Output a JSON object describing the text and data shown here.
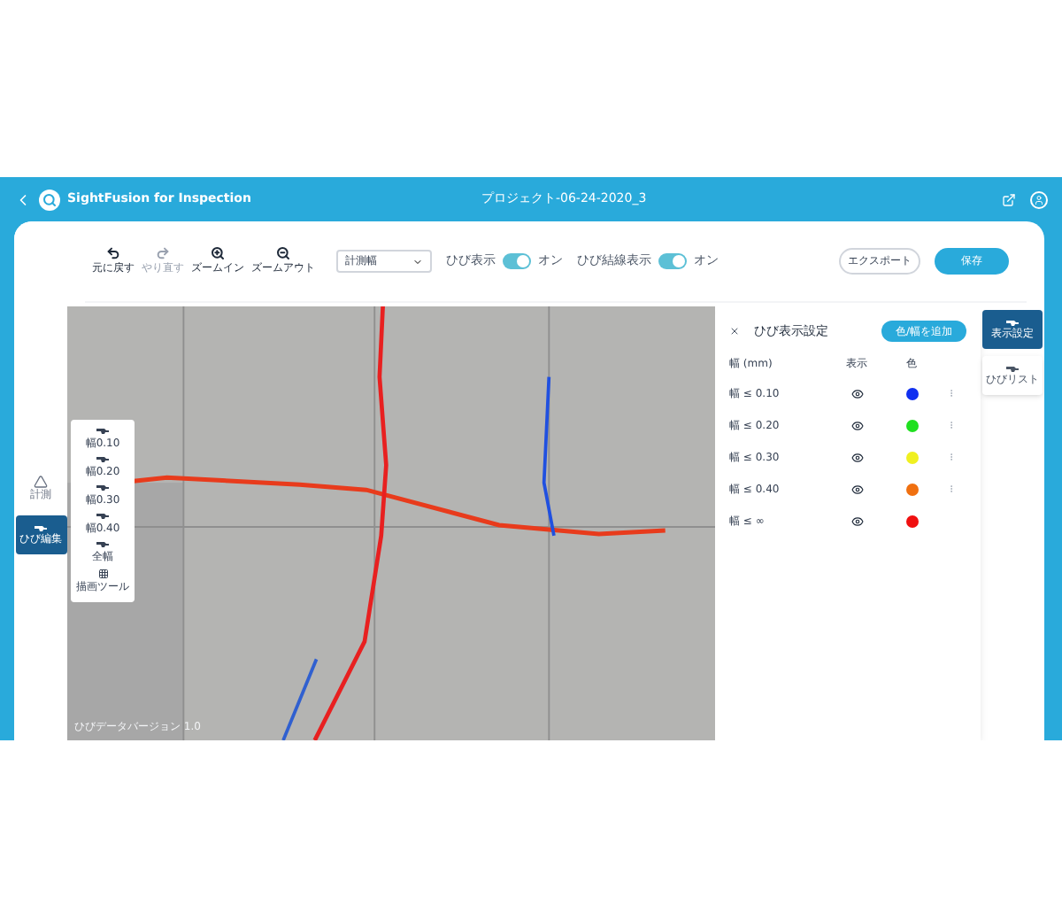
{
  "app": {
    "title": "SightFusion for Inspection",
    "project": "プロジェクト-06-24-2020_3"
  },
  "toolbar": {
    "tools": [
      {
        "label": "元に戻す",
        "disabled": false
      },
      {
        "label": "やり直す",
        "disabled": true
      },
      {
        "label": "ズームイン",
        "disabled": false
      },
      {
        "label": "ズームアウト",
        "disabled": false
      }
    ],
    "dropdown": {
      "value": "計測幅"
    },
    "toggles": [
      {
        "label": "ひび表示",
        "on": true,
        "state": "オン"
      },
      {
        "label": "ひび結線表示",
        "on": true,
        "state": "オン"
      }
    ],
    "export": "エクスポート",
    "save": "保存"
  },
  "left_sidebar": [
    {
      "label": "計測",
      "selected": false,
      "kind": "ruler"
    },
    {
      "label": "ひび編集",
      "selected": true,
      "kind": "crack"
    }
  ],
  "palette": [
    {
      "label": "幅0.10",
      "kind": "crack"
    },
    {
      "label": "幅0.20",
      "kind": "crack"
    },
    {
      "label": "幅0.30",
      "kind": "crack"
    },
    {
      "label": "幅0.40",
      "kind": "crack"
    },
    {
      "label": "全幅",
      "kind": "crack"
    },
    {
      "label": "描画ツール",
      "kind": "grid"
    }
  ],
  "canvas": {
    "caption": "ひびデータバージョン 1.0"
  },
  "panel": {
    "title": "ひび表示設定",
    "add_button": "色/幅を追加",
    "columns": [
      "幅 (mm)",
      "表示",
      "色"
    ],
    "rows": [
      {
        "width": "幅 ≤ 0.10",
        "visible": true,
        "color": "#1030f0",
        "menu": true
      },
      {
        "width": "幅 ≤ 0.20",
        "visible": true,
        "color": "#20e020",
        "menu": true
      },
      {
        "width": "幅 ≤ 0.30",
        "visible": true,
        "color": "#f0f020",
        "menu": true
      },
      {
        "width": "幅 ≤ 0.40",
        "visible": true,
        "color": "#f07010",
        "menu": true
      },
      {
        "width": "幅 ≤ ∞",
        "visible": true,
        "color": "#f01010",
        "menu": false
      }
    ]
  },
  "right_tabs": [
    {
      "label": "表示設定",
      "selected": true
    },
    {
      "label": "ひびリスト",
      "selected": false
    }
  ]
}
